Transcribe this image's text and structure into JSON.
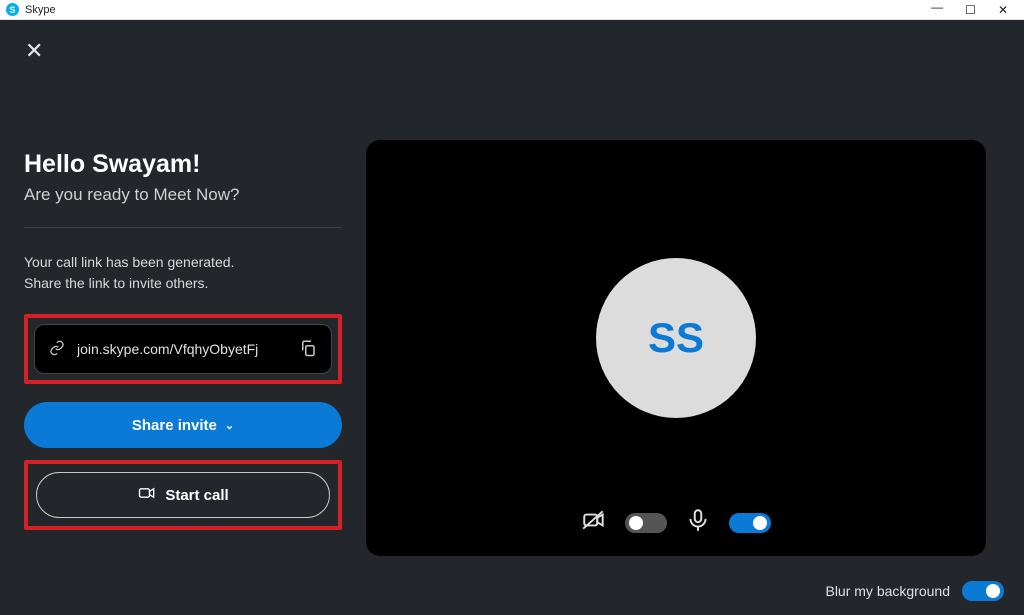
{
  "window": {
    "app_title": "Skype"
  },
  "left": {
    "greeting": "Hello Swayam!",
    "subtitle": "Are you ready to Meet Now?",
    "info_line1": "Your call link has been generated.",
    "info_line2": "Share the link to invite others.",
    "link_url": "join.skype.com/VfqhyObyetFj",
    "share_label": "Share invite",
    "start_label": "Start call"
  },
  "video": {
    "avatar_initials": "SS",
    "camera_on": false,
    "mic_on": true
  },
  "footer": {
    "blur_label": "Blur my background",
    "blur_on": true
  }
}
